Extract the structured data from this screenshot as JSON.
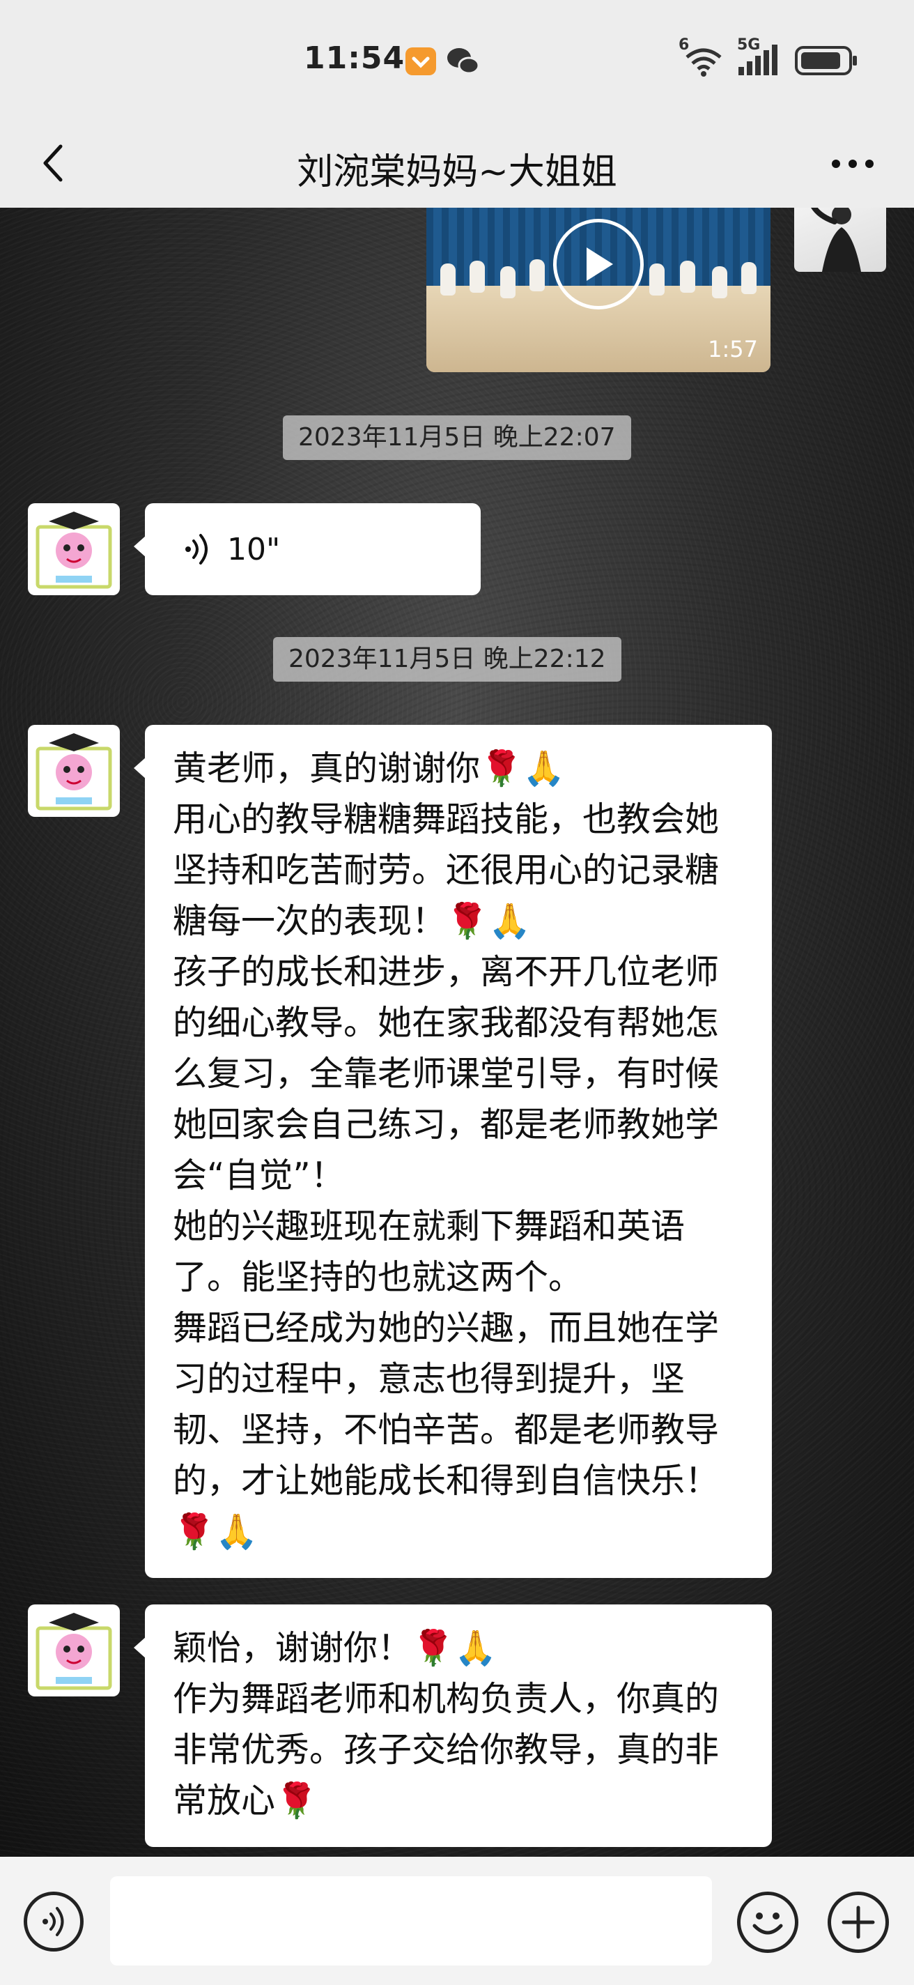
{
  "status": {
    "time": "11:54",
    "signal_label": "5G",
    "wifi_label": "6"
  },
  "nav": {
    "title": "刘涴棠妈妈~大姐姐",
    "back_icon": "chevron-left-icon",
    "more_icon": "more-dots-icon"
  },
  "messages": {
    "video": {
      "duration": "1:57"
    },
    "timestamp_1": "2023年11月5日 晚上22:07",
    "voice": {
      "duration": "10\""
    },
    "timestamp_2": "2023年11月5日 晚上22:12",
    "text_1": [
      "黄老师，真的谢谢你🌹🙏",
      "用心的教导糖糖舞蹈技能，也教会她坚持和吃苦耐劳。还很用心的记录糖糖每一次的表现！🌹🙏",
      "孩子的成长和进步，离不开几位老师的细心教导。她在家我都没有帮她怎么复习，全靠老师课堂引导，有时候她回家会自己练习，都是老师教她学会“自觉”！",
      "她的兴趣班现在就剩下舞蹈和英语了。能坚持的也就这两个。",
      "舞蹈已经成为她的兴趣，而且她在学习的过程中，意志也得到提升，坚韧、坚持，不怕辛苦。都是老师教导的，才让她能成长和得到自信快乐！🌹🙏"
    ],
    "text_2": [
      "颖怡，谢谢你！🌹🙏",
      "作为舞蹈老师和机构负责人，你真的非常优秀。孩子交给你教导，真的非常放心🌹"
    ]
  },
  "input_bar": {
    "voice_icon": "voice-toggle-icon",
    "emoji_icon": "emoji-icon",
    "plus_icon": "plus-icon"
  }
}
